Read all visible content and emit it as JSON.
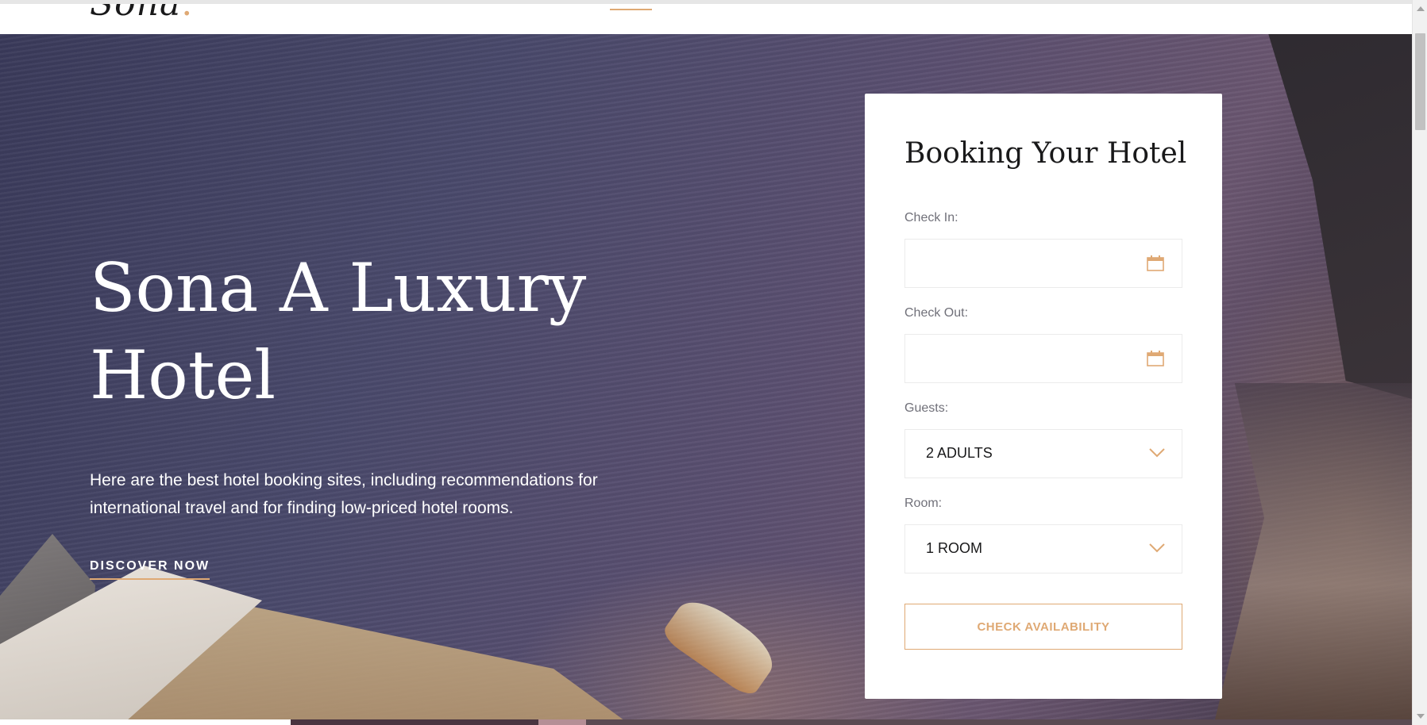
{
  "header": {
    "logo_text": "Sona",
    "logo_dot": "."
  },
  "hero": {
    "title": "Sona A Luxury Hotel",
    "description": "Here are the best hotel booking sites, including recommendations for international travel and for finding low-priced hotel rooms.",
    "cta_label": "DISCOVER NOW"
  },
  "booking": {
    "title": "Booking Your Hotel",
    "check_in_label": "Check In:",
    "check_in_value": "",
    "check_out_label": "Check Out:",
    "check_out_value": "",
    "guests_label": "Guests:",
    "guests_value": "2 ADULTS",
    "room_label": "Room:",
    "room_value": "1 ROOM",
    "submit_label": "Check Availability"
  },
  "colors": {
    "accent": "#dfa974",
    "text_dark": "#19191a",
    "text_muted": "#707079"
  },
  "icons": {
    "calendar": "calendar-icon",
    "chevron": "chevron-down-icon"
  }
}
